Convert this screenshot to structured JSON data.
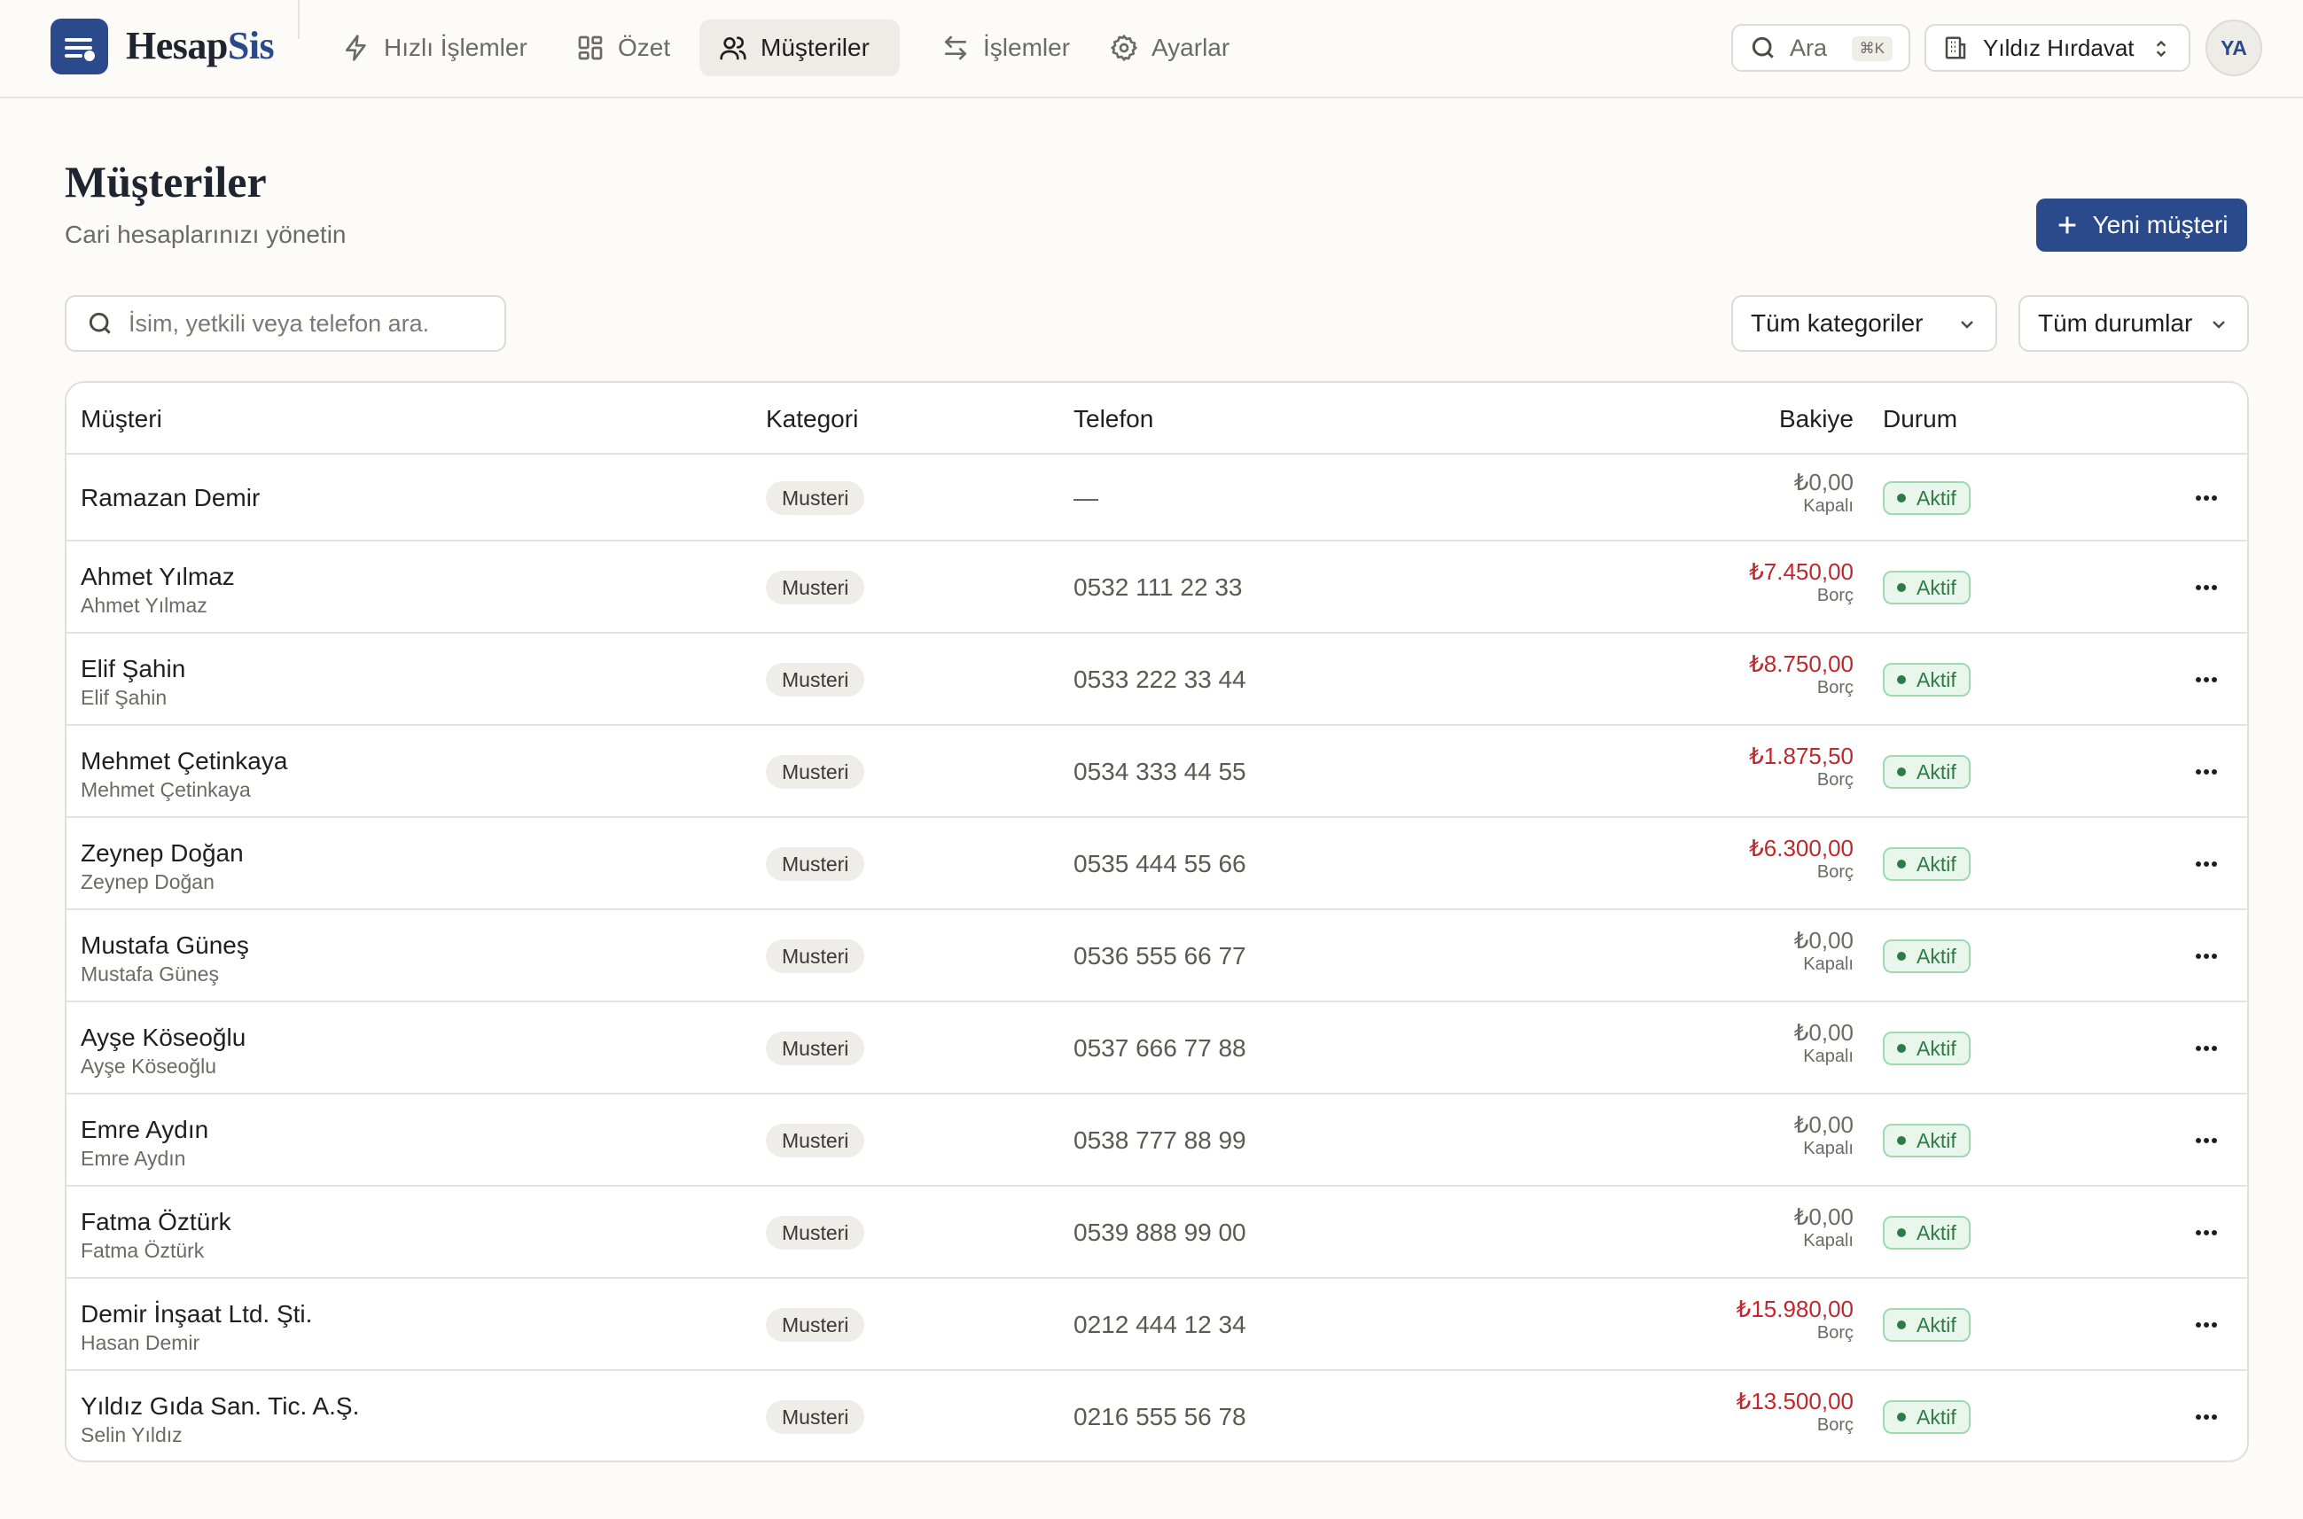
{
  "app": {
    "brand_a": "Hesap",
    "brand_b": "Sis"
  },
  "nav": [
    {
      "label": "Hızlı İşlemler",
      "icon": "zap-icon"
    },
    {
      "label": "Özet",
      "icon": "grid-icon"
    },
    {
      "label": "Müşteriler",
      "icon": "users-icon",
      "active": true
    },
    {
      "label": "İşlemler",
      "icon": "arrows-icon"
    },
    {
      "label": "Ayarlar",
      "icon": "gear-icon"
    }
  ],
  "search": {
    "label": "Ara",
    "shortcut": "⌘K"
  },
  "company": {
    "name": "Yıldız Hırdavat"
  },
  "user": {
    "initials": "YA"
  },
  "page": {
    "title": "Müşteriler",
    "subtitle": "Cari hesaplarınızı yönetin",
    "new_button": "Yeni müşteri"
  },
  "filters": {
    "search_placeholder": "İsim, yetkili veya telefon ara.",
    "category": "Tüm kategoriler",
    "status": "Tüm durumlar"
  },
  "table": {
    "headers": {
      "customer": "Müşteri",
      "category": "Kategori",
      "phone": "Telefon",
      "balance": "Bakiye",
      "status": "Durum"
    },
    "rows": [
      {
        "name": "Ramazan Demir",
        "contact": "",
        "category": "Musteri",
        "phone": "—",
        "balance": "₺0,00",
        "balance_label": "Kapalı",
        "debt": false,
        "status": "Aktif"
      },
      {
        "name": "Ahmet Yılmaz",
        "contact": "Ahmet Yılmaz",
        "category": "Musteri",
        "phone": "0532 111 22 33",
        "balance": "₺7.450,00",
        "balance_label": "Borç",
        "debt": true,
        "status": "Aktif"
      },
      {
        "name": "Elif Şahin",
        "contact": "Elif Şahin",
        "category": "Musteri",
        "phone": "0533 222 33 44",
        "balance": "₺8.750,00",
        "balance_label": "Borç",
        "debt": true,
        "status": "Aktif"
      },
      {
        "name": "Mehmet Çetinkaya",
        "contact": "Mehmet Çetinkaya",
        "category": "Musteri",
        "phone": "0534 333 44 55",
        "balance": "₺1.875,50",
        "balance_label": "Borç",
        "debt": true,
        "status": "Aktif"
      },
      {
        "name": "Zeynep Doğan",
        "contact": "Zeynep Doğan",
        "category": "Musteri",
        "phone": "0535 444 55 66",
        "balance": "₺6.300,00",
        "balance_label": "Borç",
        "debt": true,
        "status": "Aktif"
      },
      {
        "name": "Mustafa Güneş",
        "contact": "Mustafa Güneş",
        "category": "Musteri",
        "phone": "0536 555 66 77",
        "balance": "₺0,00",
        "balance_label": "Kapalı",
        "debt": false,
        "status": "Aktif"
      },
      {
        "name": "Ayşe Köseoğlu",
        "contact": "Ayşe Köseoğlu",
        "category": "Musteri",
        "phone": "0537 666 77 88",
        "balance": "₺0,00",
        "balance_label": "Kapalı",
        "debt": false,
        "status": "Aktif"
      },
      {
        "name": "Emre Aydın",
        "contact": "Emre Aydın",
        "category": "Musteri",
        "phone": "0538 777 88 99",
        "balance": "₺0,00",
        "balance_label": "Kapalı",
        "debt": false,
        "status": "Aktif"
      },
      {
        "name": "Fatma Öztürk",
        "contact": "Fatma Öztürk",
        "category": "Musteri",
        "phone": "0539 888 99 00",
        "balance": "₺0,00",
        "balance_label": "Kapalı",
        "debt": false,
        "status": "Aktif"
      },
      {
        "name": "Demir İnşaat Ltd. Şti.",
        "contact": "Hasan Demir",
        "category": "Musteri",
        "phone": "0212 444 12 34",
        "balance": "₺15.980,00",
        "balance_label": "Borç",
        "debt": true,
        "status": "Aktif"
      },
      {
        "name": "Yıldız Gıda San. Tic. A.Ş.",
        "contact": "Selin Yıldız",
        "category": "Musteri",
        "phone": "0216 555 56 78",
        "balance": "₺13.500,00",
        "balance_label": "Borç",
        "debt": true,
        "status": "Aktif"
      }
    ]
  },
  "colors": {
    "accent": "#2b4a8b",
    "debt": "#c0282d",
    "active_green": "#2f7a48",
    "background": "#fcfbf8"
  }
}
